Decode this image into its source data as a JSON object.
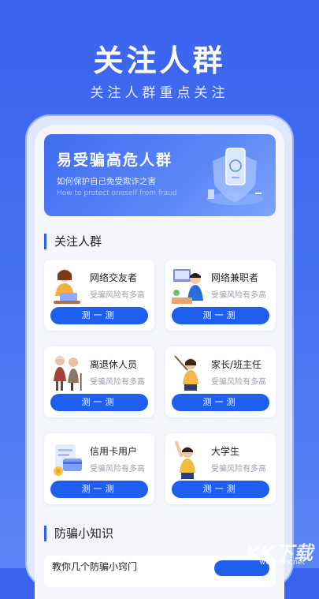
{
  "hero": {
    "title": "关注人群",
    "subtitle": "关注人群重点关注"
  },
  "banner": {
    "title": "易受骗高危人群",
    "subtitle": "如何保护自己免受欺诈之害",
    "subtitle_en": "How to protect oneself from fraud"
  },
  "section_groups": {
    "title": "关注人群"
  },
  "groups": [
    {
      "name": "网络交友者",
      "desc": "受骗风险有多高",
      "button": "测一测",
      "icon": "woman-with-laptop-illustration"
    },
    {
      "name": "网络兼职者",
      "desc": "受骗风险有多高",
      "button": "测一测",
      "icon": "man-at-computer-illustration"
    },
    {
      "name": "离退休人员",
      "desc": "受骗风险有多高",
      "button": "测一测",
      "icon": "elderly-couple-illustration"
    },
    {
      "name": "家长/班主任",
      "desc": "受骗风险有多高",
      "button": "测一测",
      "icon": "teacher-pointer-illustration"
    },
    {
      "name": "信用卡用户",
      "desc": "受骗风险有多高",
      "button": "测一测",
      "icon": "credit-card-illustration"
    },
    {
      "name": "大学生",
      "desc": "受骗风险有多高",
      "button": "测一测",
      "icon": "student-cheering-illustration"
    }
  ],
  "section_tips": {
    "title": "防骗小知识"
  },
  "tips": {
    "first_item": "教你几个防骗小窍门"
  },
  "watermark": {
    "brand": "KK下载",
    "url": "www.kkx.net"
  },
  "colors": {
    "primary": "#1f5ff0",
    "background": "#3a63ef",
    "accent_line": "#2f62e8"
  }
}
